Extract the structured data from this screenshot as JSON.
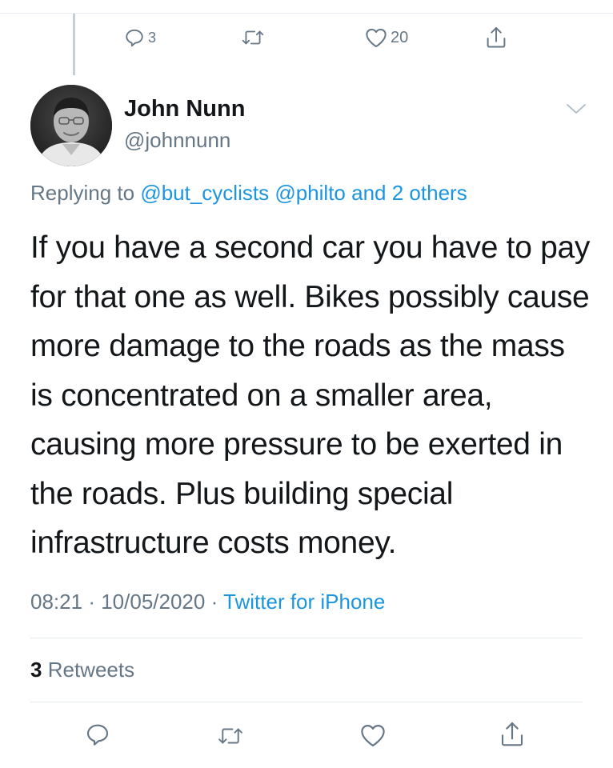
{
  "parent_tweet": {
    "reply_count": "3",
    "like_count": "20",
    "icons": [
      "reply-icon",
      "retweet-icon",
      "like-icon",
      "share-icon"
    ]
  },
  "author": {
    "display_name": "John Nunn",
    "handle": "@johnnunn"
  },
  "replying_to": {
    "prefix": "Replying to",
    "mention_1": "@but_cyclists",
    "mention_2": "@philto",
    "connector": "and",
    "others": "2 others"
  },
  "tweet": {
    "text": "If you have a second car you have to pay for that one as well. Bikes possibly cause more damage to the roads as the mass is concentrated on a smaller area, causing more pressure to be exerted in the roads. Plus building special infrastructure costs money.",
    "time": "08:21",
    "separator": "·",
    "date": "10/05/2020",
    "source": "Twitter for iPhone"
  },
  "stats": {
    "retweet_count": "3",
    "retweet_label": "Retweets"
  },
  "actions": {
    "icons": [
      "reply-icon",
      "retweet-icon",
      "like-icon",
      "share-icon"
    ]
  },
  "colors": {
    "text": "#14171a",
    "secondary": "#657786",
    "link": "#1b95e0",
    "divider": "#e1e8ed"
  }
}
